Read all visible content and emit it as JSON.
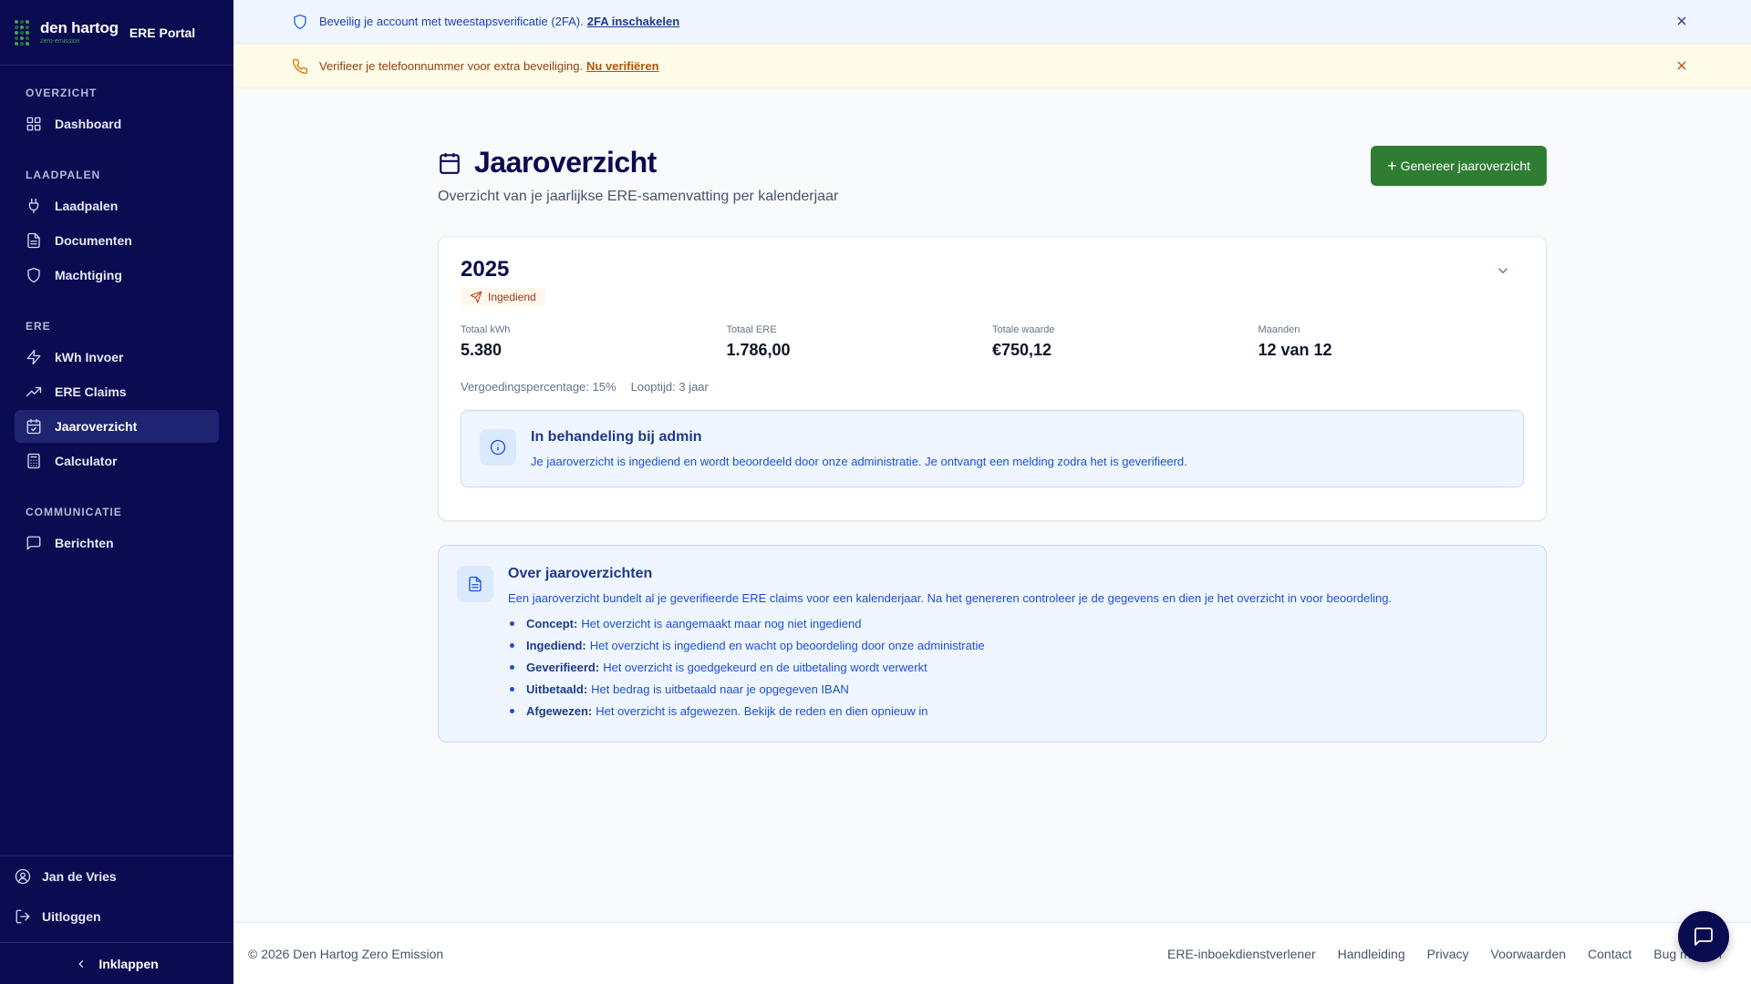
{
  "brand": {
    "name": "den hartog",
    "sub": "zero-emission",
    "portal": "ERE Portal"
  },
  "sidebar": {
    "sections": [
      {
        "title": "OVERZICHT",
        "items": [
          {
            "label": "Dashboard",
            "icon": "grid-icon"
          }
        ]
      },
      {
        "title": "LAADPALEN",
        "items": [
          {
            "label": "Laadpalen",
            "icon": "plug-icon"
          },
          {
            "label": "Documenten",
            "icon": "document-icon"
          },
          {
            "label": "Machtiging",
            "icon": "shield-icon"
          }
        ]
      },
      {
        "title": "ERE",
        "items": [
          {
            "label": "kWh Invoer",
            "icon": "lightning-icon"
          },
          {
            "label": "ERE Claims",
            "icon": "trend-up-icon"
          },
          {
            "label": "Jaaroverzicht",
            "icon": "calendar-check-icon",
            "active": true
          },
          {
            "label": "Calculator",
            "icon": "calculator-icon"
          }
        ]
      },
      {
        "title": "COMMUNICATIE",
        "items": [
          {
            "label": "Berichten",
            "icon": "message-icon"
          }
        ]
      }
    ],
    "user": "Jan de Vries",
    "logout": "Uitloggen",
    "collapse": "Inklappen"
  },
  "banners": {
    "twofa": {
      "text": "Beveilig je account met tweestapsverificatie (2FA).",
      "link": "2FA inschakelen"
    },
    "phone": {
      "text": "Verifieer je telefoonnummer voor extra beveiliging.",
      "link": "Nu verifiëren"
    }
  },
  "page": {
    "title": "Jaaroverzicht",
    "subtitle": "Overzicht van je jaarlijkse ERE-samenvatting per kalenderjaar",
    "generate_button": "Genereer jaaroverzicht"
  },
  "year_card": {
    "year": "2025",
    "status": "Ingediend",
    "stats": [
      {
        "label": "Totaal kWh",
        "value": "5.380"
      },
      {
        "label": "Totaal ERE",
        "value": "1.786,00"
      },
      {
        "label": "Totale waarde",
        "value": "€750,12"
      },
      {
        "label": "Maanden",
        "value": "12 van 12"
      }
    ],
    "rate": "Vergoedingspercentage: 15%",
    "term": "Looptijd: 3 jaar",
    "notice_title": "In behandeling bij admin",
    "notice_text": "Je jaaroverzicht is ingediend en wordt beoordeeld door onze administratie. Je ontvangt een melding zodra het is geverifieerd."
  },
  "info": {
    "title": "Over jaaroverzichten",
    "text": "Een jaaroverzicht bundelt al je geverifieerde ERE claims voor een kalenderjaar. Na het genereren controleer je de gegevens en dien je het overzicht in voor beoordeling.",
    "items": [
      {
        "term": "Concept:",
        "desc": "Het overzicht is aangemaakt maar nog niet ingediend"
      },
      {
        "term": "Ingediend:",
        "desc": "Het overzicht is ingediend en wacht op beoordeling door onze administratie"
      },
      {
        "term": "Geverifieerd:",
        "desc": "Het overzicht is goedgekeurd en de uitbetaling wordt verwerkt"
      },
      {
        "term": "Uitbetaald:",
        "desc": "Het bedrag is uitbetaald naar je opgegeven IBAN"
      },
      {
        "term": "Afgewezen:",
        "desc": "Het overzicht is afgewezen. Bekijk de reden en dien opnieuw in"
      }
    ]
  },
  "footer": {
    "copyright": "© 2026 Den Hartog Zero Emission",
    "links": [
      "ERE-inboekdienstverlener",
      "Handleiding",
      "Privacy",
      "Voorwaarden",
      "Contact",
      "Bug melden"
    ]
  },
  "colors": {
    "sidebar": "#0b0b52",
    "accent_green": "#2e7d32",
    "info_blue": "#1d4ed8"
  }
}
